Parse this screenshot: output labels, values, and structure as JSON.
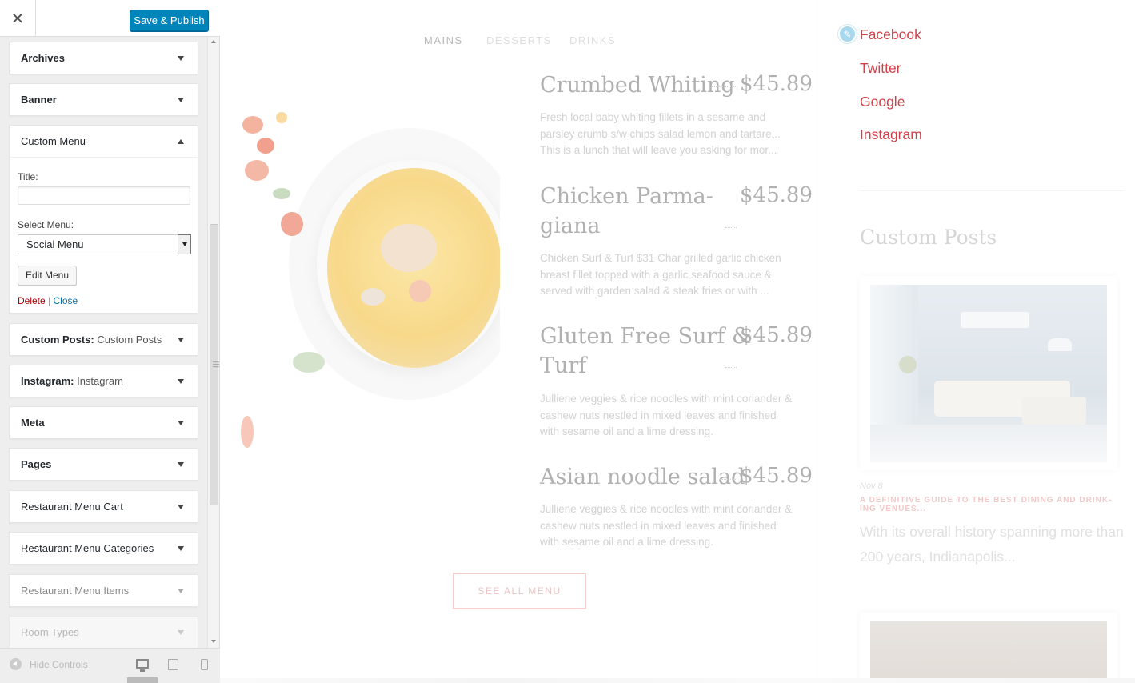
{
  "header": {
    "close_icon": "close-icon",
    "close_glyph": "✕",
    "publish_label": "Save & Publish"
  },
  "widgets": [
    {
      "label": "Archives",
      "sub": "",
      "state": "collapsed"
    },
    {
      "label": "Banner",
      "sub": "",
      "state": "collapsed"
    },
    {
      "label": "Custom Menu",
      "sub": "",
      "state": "expanded"
    },
    {
      "label": "Custom Posts:",
      "sub": "Custom Posts",
      "state": "collapsed"
    },
    {
      "label": "Instagram:",
      "sub": "Instagram",
      "state": "collapsed"
    },
    {
      "label": "Meta",
      "sub": "",
      "state": "collapsed"
    },
    {
      "label": "Pages",
      "sub": "",
      "state": "collapsed"
    },
    {
      "label": "Restaurant Menu Cart",
      "sub": "",
      "state": "collapsed"
    },
    {
      "label": "Restaurant Menu Categories",
      "sub": "",
      "state": "collapsed"
    },
    {
      "label": "Restaurant Menu Items",
      "sub": "",
      "state": "collapsed"
    },
    {
      "label": "Room Types",
      "sub": "",
      "state": "collapsed"
    }
  ],
  "custom_menu_form": {
    "title_label": "Title:",
    "title_value": "",
    "select_label": "Select Menu:",
    "select_value": "Social Menu",
    "edit_button": "Edit Menu",
    "delete_link": "Delete",
    "separator": "|",
    "close_link": "Close"
  },
  "footer": {
    "hide_controls": "Hide Controls",
    "devices": [
      "desktop-icon",
      "tablet-icon",
      "mobile-icon"
    ]
  },
  "preview": {
    "menu_tabs": [
      "MAINS",
      "DESSERTS",
      "DRINKS"
    ],
    "active_tab": "MAINS",
    "menu_items": [
      {
        "name": "Crumbed Whiting",
        "price": "$45.89",
        "description": "Fresh local baby whiting fillets in a sesame and parsley crumb s/w chips salad lemon and tartare... This is a lunch that will leave you asking for mor..."
      },
      {
        "name": "Chicken Parma-giana",
        "name_line1": "Chicken Parma-",
        "name_line2": "giana",
        "price": "$45.89",
        "description": "Chicken Surf & Turf $31 Char grilled garlic chicken breast fillet topped with a garlic seafood sauce & served with garden salad & steak fries or with ..."
      },
      {
        "name": "Gluten Free Surf & Turf",
        "name_line1": "Gluten Free Surf &",
        "name_line2": "Turf",
        "price": "$45.89",
        "description": "Julliene veggies & rice noodles with mint coriander & cashew nuts nestled in mixed leaves and finished with sesame oil and a lime dressing."
      },
      {
        "name": "Asian noodle salad",
        "price": "$45.89",
        "description": "Julliene veggies & rice noodles with mint coriander & cashew nuts nestled in mixed leaves and finished with sesame oil and a lime dressing."
      }
    ],
    "see_all_button": "SEE ALL MENU",
    "social_links": [
      "Facebook",
      "Twitter",
      "Google",
      "Instagram"
    ],
    "custom_posts_title": "Custom Posts",
    "post": {
      "date": "Nov 8",
      "title": "A DEFINITIVE GUIDE TO THE BEST DINING AND DRINK-ING VENUES...",
      "excerpt": "With its overall history spanning more than 200 years, Indianapolis..."
    }
  },
  "colors": {
    "accent": "#0085ba",
    "link_red": "#d0414a",
    "delete_red": "#aa0000",
    "close_blue": "#0073aa"
  }
}
